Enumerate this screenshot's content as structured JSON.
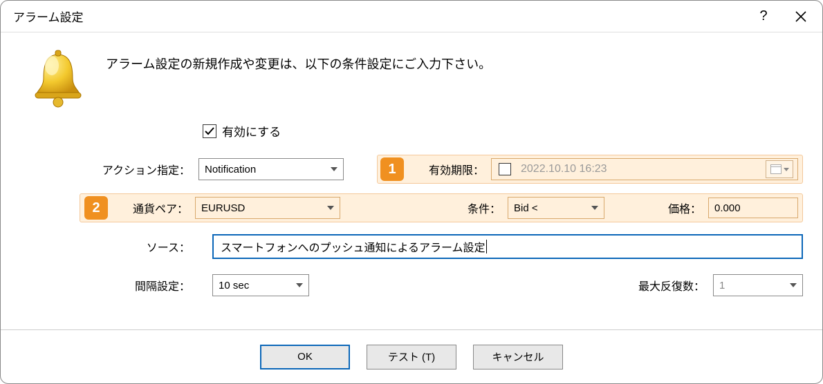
{
  "window": {
    "title": "アラーム設定"
  },
  "intro": "アラーム設定の新規作成や変更は、以下の条件設定にご入力下さい。",
  "enable": {
    "label": "有効にする",
    "checked": true
  },
  "badges": {
    "one": "1",
    "two": "2"
  },
  "labels": {
    "action": "アクション指定：",
    "expiry": "有効期限：",
    "pair": "通貨ペア：",
    "condition": "条件：",
    "price": "価格：",
    "source": "ソース：",
    "interval": "間隔設定：",
    "maxReps": "最大反復数："
  },
  "fields": {
    "action": "Notification",
    "expiry_checked": false,
    "expiry_date": "2022.10.10 16:23",
    "pair": "EURUSD",
    "condition": "Bid <",
    "price": "0.000",
    "source": "スマートフォンへのプッシュ通知によるアラーム設定",
    "interval": "10 sec",
    "maxReps": "1"
  },
  "buttons": {
    "ok": "OK",
    "test": "テスト (T)",
    "cancel": "キャンセル"
  }
}
